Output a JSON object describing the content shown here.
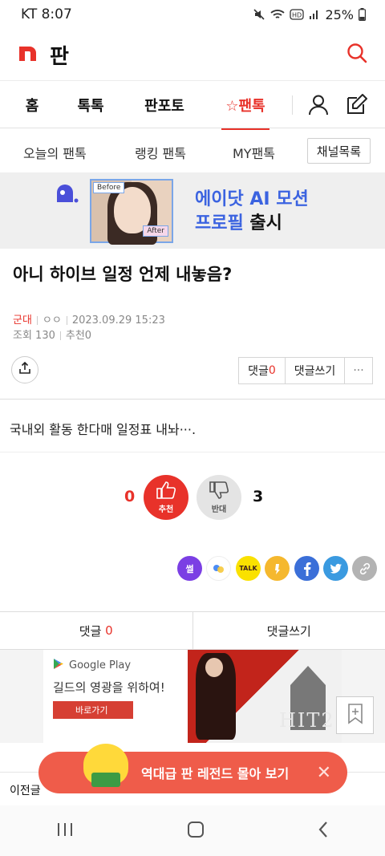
{
  "status_bar": {
    "carrier_time": "KT 8:07",
    "battery": "25%",
    "icons": [
      "mute-icon",
      "wifi-icon",
      "hd-icon",
      "signal-icon",
      "battery-icon"
    ]
  },
  "app": {
    "brand_letter": "n",
    "title": "판",
    "brand_color": "#e8322a"
  },
  "gnb": {
    "items": [
      {
        "label": "홈"
      },
      {
        "label": "톡톡"
      },
      {
        "label": "판포토"
      },
      {
        "label": "☆팬톡",
        "active": true
      }
    ]
  },
  "subnav": {
    "items": [
      "오늘의 팬톡",
      "랭킹 팬톡",
      "MY팬톡"
    ],
    "channel_button": "채널목록"
  },
  "banner": {
    "line1": "에이닷 AI 모션",
    "line2a": "프로필",
    "line2b": "출시",
    "before_tag": "Before",
    "after_tag": "After"
  },
  "post": {
    "title": "아니 하이브 일정 언제 내놓음?",
    "author": "군대",
    "group": "ㅇㅇ",
    "date": "2023.09.29 15:23",
    "views": "조회 130",
    "recommends": "추천0",
    "body": "국내외 활동 한다매 일정표 내놔···."
  },
  "actions": {
    "comment_label": "댓글",
    "comment_count": "0",
    "write_label": "댓글쓰기",
    "more": "···"
  },
  "vote": {
    "up_count": "0",
    "up_label": "추천",
    "down_label": "반대",
    "down_count": "3"
  },
  "share_icons": [
    "ssul-icon",
    "band-icon",
    "kakaotalk-icon",
    "kakaostory-icon",
    "facebook-icon",
    "twitter-icon",
    "link-icon"
  ],
  "share_text": {
    "ssul": "썰",
    "talk": "TALK"
  },
  "comment_bar": {
    "comments": "댓글",
    "count": "0",
    "write": "댓글쓰기"
  },
  "ad": {
    "store": "Google Play",
    "headline": "길드의 영광을 위하여!",
    "cta": "바로가기",
    "brand": "HIT2"
  },
  "promo": {
    "label": "역대급 판 레전드 몰아 보기",
    "close": "✕"
  },
  "prev_post": {
    "label": "이전글"
  }
}
